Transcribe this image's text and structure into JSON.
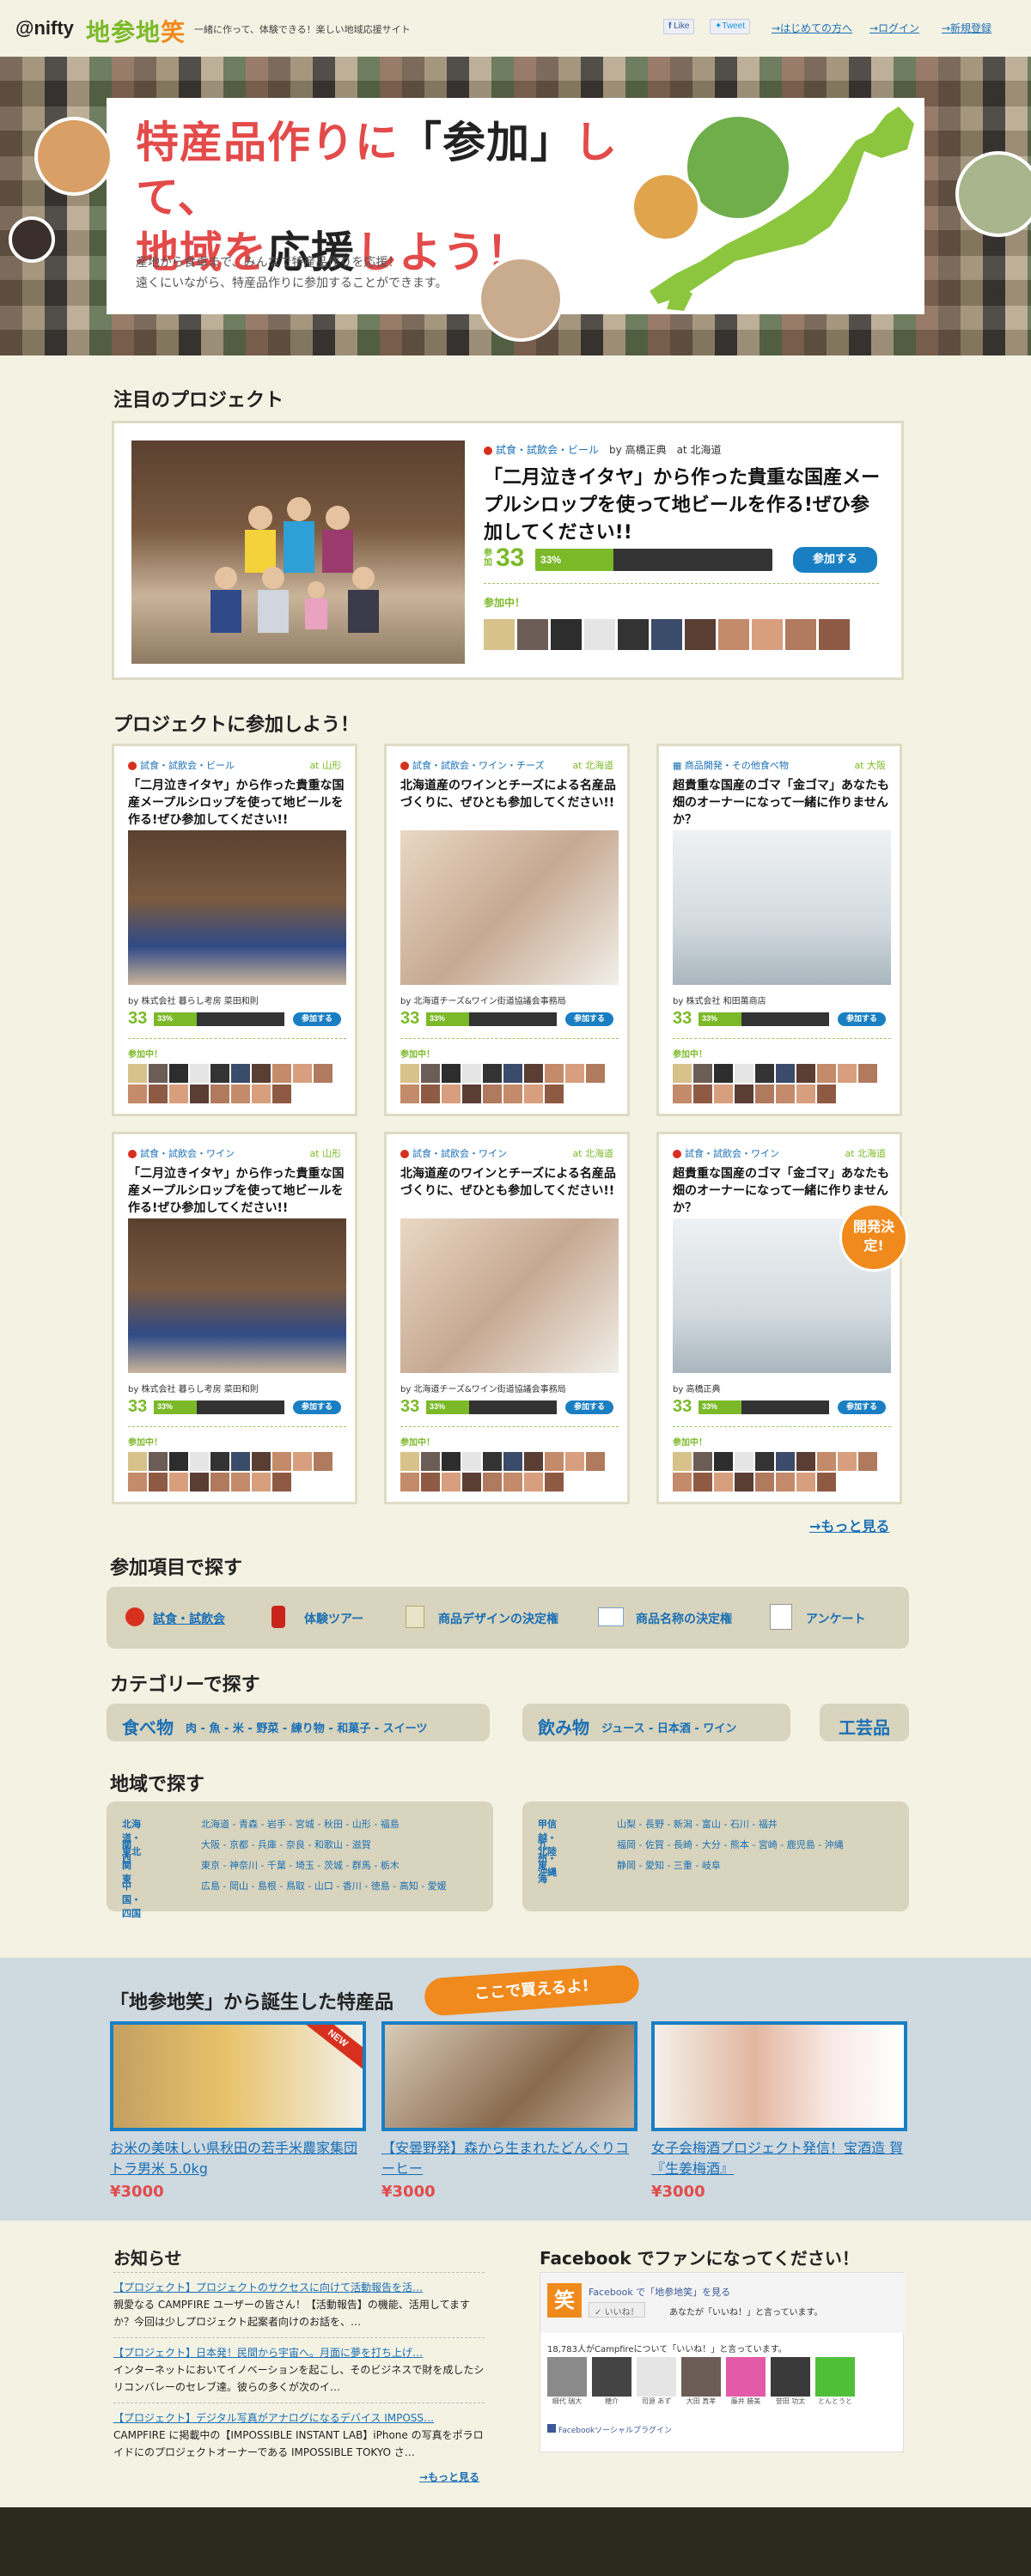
{
  "header": {
    "nifty": "@nifty",
    "brand_a": "地参地",
    "brand_b": "笑",
    "tagline": "一緒に作って、体験できる！楽しい地域応援サイト",
    "like": "Like",
    "tweet": "Tweet",
    "nav": [
      "→はじめての方へ",
      "→ログイン",
      "→新規登録"
    ]
  },
  "hero": {
    "line1_a": "特産品作りに",
    "line1_b": "「参加」",
    "line1_c": "して、",
    "line2_a": "地域を",
    "line2_b": "応援",
    "line2_c": "しよう！",
    "sub1": "産地から食卓まで、みんなで特産品作りを応援！",
    "sub2": "遠くにいながら、特産品作りに参加することができます。"
  },
  "featured": {
    "section_title": "注目のプロジェクト",
    "category": "試食・試飲会・ビール",
    "by": "by 高橋正典　at 北海道",
    "title": "「二月泣きイタヤ」から作った貴重な国産メープルシロップを使って地ビールを作る!ぜひ参加してください!!",
    "days_label": "参加",
    "count": "33",
    "progress_label": "33%",
    "progress": 0.33,
    "join": "参加する",
    "participating": "参加中！"
  },
  "grid": {
    "section_title": "プロジェクトに参加しよう！",
    "cards": [
      {
        "cat": "試食・試飲会・ビール",
        "loc": "at 山形",
        "title": "「二月泣きイタヤ」から作った貴重な国産メープルシロップを使って地ビールを作る!ぜひ参加してください!!",
        "by": "by 株式会社 暮らし考房 菜田和則",
        "n": "33",
        "pct": "33%",
        "join": "参加する",
        "p": "参加中！"
      },
      {
        "cat": "試食・試飲会・ワイン・チーズ",
        "loc": "at 北海道",
        "title": "北海道産のワインとチーズによる名産品づくりに、ぜひとも参加してください!!",
        "by": "by 北海道チーズ&ワイン街道協議会事務局",
        "n": "33",
        "pct": "33%",
        "join": "参加する",
        "p": "参加中！"
      },
      {
        "cat": "商品開発・その他食べ物",
        "loc": "at 大阪",
        "title": "超貴重な国産のゴマ「金ゴマ」あなたも畑のオーナーになって一緒に作りませんか？",
        "by": "by 株式会社 和田萬商店",
        "n": "33",
        "pct": "33%",
        "join": "参加する",
        "p": "参加中！"
      },
      {
        "cat": "試食・試飲会・ワイン",
        "loc": "at 山形",
        "title": "「二月泣きイタヤ」から作った貴重な国産メープルシロップを使って地ビールを作る!ぜひ参加してください!!",
        "by": "by 株式会社 暮らし考房 菜田和則",
        "n": "33",
        "pct": "33%",
        "join": "参加する",
        "p": "参加中！"
      },
      {
        "cat": "試食・試飲会・ワイン",
        "loc": "at 北海道",
        "title": "北海道産のワインとチーズによる名産品づくりに、ぜひとも参加してください!!",
        "by": "by 北海道チーズ&ワイン街道協議会事務局",
        "n": "33",
        "pct": "33%",
        "join": "参加する",
        "p": "参加中！"
      },
      {
        "cat": "試食・試飲会・ワイン",
        "loc": "at 北海道",
        "title": "超貴重な国産のゴマ「金ゴマ」あなたも畑のオーナーになって一緒に作りませんか？",
        "by": "by 高橋正典",
        "n": "33",
        "pct": "33%",
        "join": "参加する",
        "p": "参加中！"
      }
    ],
    "badge": "開発決定!",
    "more": "→もっと見る"
  },
  "items_search": {
    "title": "参加項目で探す",
    "items": [
      "試食・試飲会",
      "体験ツアー",
      "商品デザインの決定権",
      "商品名称の決定権",
      "アンケート"
    ]
  },
  "category_search": {
    "title": "カテゴリーで探す",
    "food_head": "食べ物",
    "food": "肉 - 魚 - 米 - 野菜 - 練り物 - 和菓子 - スイーツ",
    "drink_head": "飲み物",
    "drink": "ジュース - 日本酒 - ワイン",
    "craft_head": "工芸品"
  },
  "region_search": {
    "title": "地域で探す",
    "left": [
      {
        "k": "北海道・東北",
        "v": "北海道 - 青森 - 岩手 - 宮城 - 秋田 - 山形 - 福島"
      },
      {
        "k": "関西",
        "v": "大阪 - 京都 - 兵庫 - 奈良 - 和歌山 - 滋賀"
      },
      {
        "k": "関東",
        "v": "東京 - 神奈川 - 千葉 - 埼玉 - 茨城 - 群馬 - 栃木"
      },
      {
        "k": "中国・四国",
        "v": "広島 - 岡山 - 島根 - 鳥取 - 山口 - 香川 - 徳島 - 高知 - 愛媛"
      }
    ],
    "right": [
      {
        "k": "甲信越・北陸",
        "v": "山梨 - 長野 - 新潟 - 富山 - 石川 - 福井"
      },
      {
        "k": "九州・沖縄",
        "v": "福岡 - 佐賀 - 長崎 - 大分 - 熊本 - 宮崎 - 鹿児島 - 沖縄"
      },
      {
        "k": "東海",
        "v": "静岡 - 愛知 - 三重 - 岐阜"
      }
    ]
  },
  "products": {
    "title": "「地参地笑」から誕生した特産品",
    "bubble": "ここで買えるよ!",
    "new": "NEW",
    "items": [
      {
        "name": "お米の美味しい県秋田の若手米農家集団トラ男米 5.0kg",
        "price": "¥3000"
      },
      {
        "name": "【安曇野発】森から生まれたどんぐりコーヒー",
        "price": "¥3000"
      },
      {
        "name": "女子会梅酒プロジェクト発信！宝酒造 賀『生姜梅酒』",
        "price": "¥3000"
      }
    ]
  },
  "news": {
    "title": "お知らせ",
    "items": [
      {
        "t": "【プロジェクト】プロジェクトのサクセスに向けて活動報告を活…",
        "b": "親愛なる CAMPFIRE ユーザーの皆さん！【活動報告】の機能、活用してますか？今回は少しプロジェクト起案者向けのお話を、…"
      },
      {
        "t": "【プロジェクト】日本発！民間から宇宙へ。月面に夢を打ち上げ…",
        "b": "インターネットにおいてイノベーションを起こし、そのビジネスで財を成したシリコンバレーのセレブ達。彼らの多くが次のイ…"
      },
      {
        "t": "【プロジェクト】デジタル写真がアナログになるデバイス IMPOSS…",
        "b": "CAMPFIRE に掲載中の【IMPOSSIBLE INSTANT LAB】iPhone の写真をポラロイドにのプロジェクトオーナーである IMPOSSIBLE TOKYO さ…"
      }
    ],
    "more": "→もっと見る"
  },
  "facebook": {
    "title": "Facebook でファンになってください！",
    "page_link": "Facebook で「地参地笑」を見る",
    "like": "いいね！",
    "liked": "あなたが「いいね！」と言っています。",
    "count": "18,783人がCampfireについて「いいね！」と言っています。",
    "fans": [
      "細代 瑞大",
      "穂介",
      "司源 あず",
      "大田 真孝",
      "藤井 勝美",
      "誉田 功太",
      "とんとうと"
    ],
    "plugin": "Facebookソーシャルプラグイン"
  },
  "colors": {
    "accent": "#7cb929",
    "link": "#1a6fb5",
    "red": "#e24b4a",
    "bg": "#f4f2e3"
  }
}
